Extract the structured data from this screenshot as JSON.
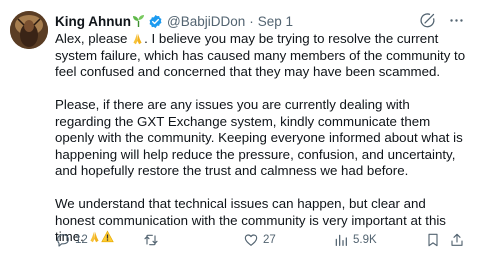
{
  "author": {
    "name": "King Ahnun",
    "handle": "@BabjiDDon",
    "date": "Sep 1",
    "separator": "·"
  },
  "body": {
    "p1_before_emoji": "Alex, please ",
    "p1_after_emoji": ". I believe you may be trying to resolve the current system failure, which has caused many members of the community to feel confused and concerned that they may have been scammed.",
    "p2": "Please, if there are any issues you are currently dealing with regarding the GXT Exchange system, kindly communicate them openly with the community. Keeping everyone informed about what is happening will help reduce the pressure, confusion, and uncertainty, and hopefully restore the trust and calmness we had before.",
    "p3": "We understand that technical issues can happen, but clear and honest communication with the community is very important at this time. "
  },
  "metrics": {
    "replies": "12",
    "reposts": "",
    "likes": "27",
    "views": "5.9K"
  },
  "icons": {
    "name_emoji": "seedling-icon",
    "verified": "verified-badge-icon",
    "grok": "grok-icon",
    "more": "more-icon",
    "reply": "reply-icon",
    "repost": "repost-icon",
    "like": "like-icon",
    "views": "views-icon",
    "bookmark": "bookmark-icon",
    "share": "share-icon",
    "pray": "pray-emoji",
    "warning": "warning-emoji"
  },
  "colors": {
    "text": "#0f1419",
    "muted": "#536471",
    "verified": "#1d9bf0",
    "background": "#ffffff"
  }
}
